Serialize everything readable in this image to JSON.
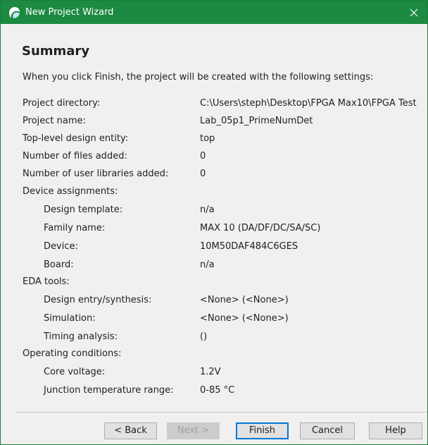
{
  "window": {
    "title": "New Project Wizard",
    "accent_color": "#1c8a42",
    "icon": "quartus-app-icon"
  },
  "page": {
    "heading": "Summary",
    "intro": "When you click Finish, the project will be created with the following settings:"
  },
  "settings": [
    {
      "label": "Project directory:",
      "value": "C:\\Users\\steph\\Desktop\\FPGA  Max10\\FPGA Test"
    },
    {
      "label": "Project name:",
      "value": "Lab_05p1_PrimeNumDet"
    },
    {
      "label": "Top-level design entity:",
      "value": "top"
    },
    {
      "label": "Number of files added:",
      "value": "0"
    },
    {
      "label": "Number of user libraries added:",
      "value": "0"
    },
    {
      "label": "Device assignments:",
      "value": ""
    },
    {
      "label": "Design template:",
      "value": "n/a"
    },
    {
      "label": "Family name:",
      "value": "MAX 10 (DA/DF/DC/SA/SC)"
    },
    {
      "label": "Device:",
      "value": "10M50DAF484C6GES"
    },
    {
      "label": "Board:",
      "value": "n/a"
    },
    {
      "label": "EDA tools:",
      "value": ""
    },
    {
      "label": "Design entry/synthesis:",
      "value": "<None> (<None>)"
    },
    {
      "label": "Simulation:",
      "value": "<None> (<None>)"
    },
    {
      "label": "Timing analysis:",
      "value": "()"
    },
    {
      "label": "Operating conditions:",
      "value": ""
    },
    {
      "label": "Core voltage:",
      "value": "1.2V"
    },
    {
      "label": "Junction temperature range:",
      "value": "0-85 °C"
    }
  ],
  "buttons": {
    "back": "< Back",
    "next": "Next >",
    "finish": "Finish",
    "cancel": "Cancel",
    "help": "Help"
  }
}
